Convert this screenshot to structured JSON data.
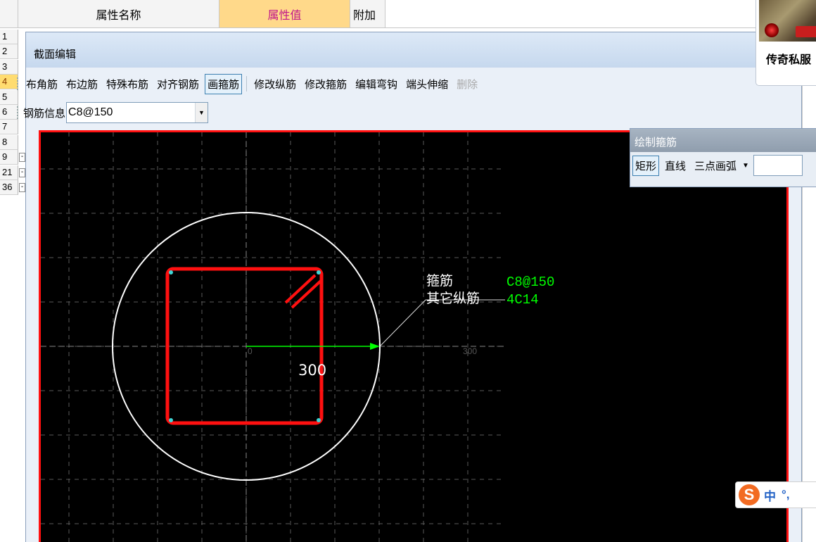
{
  "grid": {
    "headers": [
      "属性名称",
      "属性值",
      "附加"
    ],
    "header_colors": {
      "normal": "#f4f4f4",
      "selected": "#ffd98a",
      "selected_text": "#c0158b"
    },
    "rows": [
      {
        "num": "1",
        "expand": ""
      },
      {
        "num": "2",
        "expand": ""
      },
      {
        "num": "3",
        "expand": ""
      },
      {
        "num": "4",
        "expand": "",
        "selected": true
      },
      {
        "num": "5",
        "expand": ""
      },
      {
        "num": "6",
        "expand": ""
      },
      {
        "num": "7",
        "expand": ""
      },
      {
        "num": "8",
        "expand": ""
      },
      {
        "num": "9",
        "expand": "-"
      },
      {
        "num": "21",
        "expand": "-"
      },
      {
        "num": "36",
        "expand": "-"
      }
    ]
  },
  "dialog": {
    "title": "截面编辑",
    "toolbar1": [
      {
        "label": "布角筋",
        "name": "corner-rebar-button"
      },
      {
        "label": "布边筋",
        "name": "side-rebar-button"
      },
      {
        "label": "特殊布筋",
        "name": "special-rebar-button"
      },
      {
        "label": "对齐钢筋",
        "name": "align-rebar-button"
      },
      {
        "label": "画箍筋",
        "name": "draw-stirrup-button",
        "active": true
      },
      {
        "sep": true
      },
      {
        "label": "修改纵筋",
        "name": "edit-longitudinal-button"
      },
      {
        "label": "修改箍筋",
        "name": "edit-stirrup-button"
      },
      {
        "label": "编辑弯钩",
        "name": "edit-hook-button"
      },
      {
        "label": "端头伸缩",
        "name": "end-stretch-button"
      },
      {
        "label": "删除",
        "name": "delete-button",
        "disabled": true
      }
    ],
    "rebar_info_label": "钢筋信息",
    "rebar_info_value": "C8@150"
  },
  "canvas": {
    "stirrup_label": "箍筋",
    "stirrup_value": "C8@150",
    "other_label": "其它纵筋",
    "other_value": "4C14",
    "dimension": "300",
    "axis_zero": "0",
    "axis_end": "300",
    "colors": {
      "background": "#000000",
      "border": "#ff1010",
      "stirrup": "#ff1010",
      "circle": "#ffffff",
      "value_text": "#00ff00",
      "grid": "#5a5a5a"
    }
  },
  "hoop_dialog": {
    "title": "绘制箍筋",
    "tools": [
      {
        "label": "矩形",
        "name": "rectangle-mode-button",
        "active": true
      },
      {
        "label": "直线",
        "name": "line-mode-button"
      },
      {
        "label": "三点画弧",
        "name": "three-point-arc-button"
      }
    ]
  },
  "ad": {
    "text": "传奇私服"
  },
  "ime": {
    "logo": "S",
    "mode": "中",
    "punct": "°,"
  }
}
